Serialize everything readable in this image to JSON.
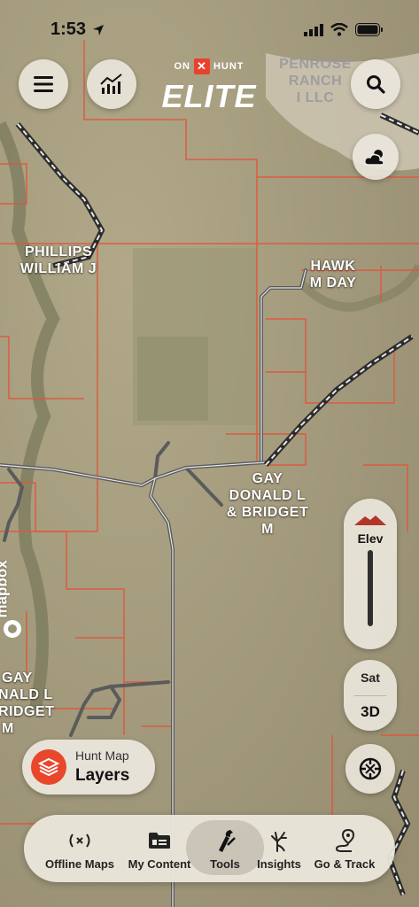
{
  "status_bar": {
    "time": "1:53"
  },
  "brand": {
    "top_left": "ON",
    "top_x": "✕",
    "top_right": "HUNT",
    "main": "ELITE"
  },
  "owners": [
    {
      "lines": [
        "PENROSE",
        "RANCH",
        "I LLC"
      ],
      "faded": true
    },
    {
      "lines": [
        "PHILLIPS",
        "WILLIAM J"
      ]
    },
    {
      "lines": [
        "HAWK",
        "M DAY"
      ]
    },
    {
      "lines": [
        "GAY",
        "DONALD L",
        "& BRIDGET",
        "M"
      ]
    },
    {
      "lines": [
        "GAY",
        "NALD L",
        "RIDGET",
        "M"
      ]
    }
  ],
  "elevation": {
    "label": "Elev"
  },
  "basemap": {
    "sat_label": "Sat",
    "mode_label": "3D"
  },
  "layers": {
    "sub_label": "Hunt Map",
    "main_label": "Layers"
  },
  "attribution": {
    "label": "mapbox"
  },
  "tabs": [
    {
      "label": "Offline Maps",
      "icon": "offline-signal-icon"
    },
    {
      "label": "My Content",
      "icon": "folder-icon"
    },
    {
      "label": "Tools",
      "icon": "tools-icon",
      "active": true
    },
    {
      "label": "Insights",
      "icon": "deer-antler-icon"
    },
    {
      "label": "Go & Track",
      "icon": "route-pin-icon"
    }
  ],
  "colors": {
    "accent": "#e8472b",
    "parcel_line": "#e0553a",
    "road": "#5b5b5b"
  }
}
